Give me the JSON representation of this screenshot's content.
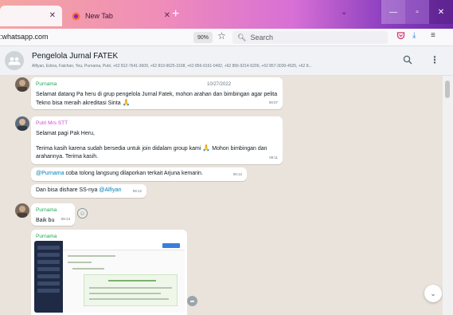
{
  "browser": {
    "active_tab_title": "",
    "inactive_tab_title": "New Tab",
    "url": ":whatsapp.com",
    "zoom": "90%",
    "search_placeholder": "Search",
    "tab_gradient": [
      "#f4a6a0",
      "#f08db9",
      "#d76fd6",
      "#8b3fbf",
      "#6a2aa8"
    ]
  },
  "chat_header": {
    "group_name": "Pengelola Jurnal FATEK",
    "members": "Alfiyan, Edora, Fatchan, You, Purnama, Putri, +62 812-7641-3609, +62 819-9625-3108, +62 856-9161-0492, +62 856-9214-5206, +62 857-3030-4025, +62 8..."
  },
  "messages": [
    {
      "sender": "Purnama",
      "sender_color": "#1fa855",
      "date": "10/27/2022",
      "text": "Selamat datang Pa heru di grup pengelola Jurnal Fatek, mohon arahan dan bimbingan agar pelita Tekno bisa meraih akreditasi Sinta",
      "emoji": "🙏",
      "time": "09:07"
    },
    {
      "sender": "Putri Mrs STT",
      "sender_color": "#c94bd0",
      "text1": "Selamat pagi Pak Heru,",
      "text2": "Terima kasih karena sudah bersedia untuk join didalam group kami",
      "text2b": "Mohon bimbingan dan arahannya. Terima kasih.",
      "emoji": "🙏",
      "time": "09:11"
    },
    {
      "mention": "@Purnama",
      "text": "coba tolong langsung dilaporkan terkait Arjuna kemarin.",
      "time": "09:12"
    },
    {
      "text": "Dan bisa dishare SS-nya",
      "mention": "@Alfiyan",
      "time": "09:12"
    },
    {
      "sender": "Purnama",
      "sender_color": "#1fa855",
      "text": "Baik bu",
      "time": "09:13"
    },
    {
      "sender": "Purnama",
      "sender_color": "#1fa855",
      "type": "image"
    }
  ],
  "icons": {
    "whatsapp_favicon": "whatsapp-icon",
    "newtab_favicon": "firefox-icon",
    "group_avatar": "group-icon",
    "react": "smiley-icon",
    "forward": "forward-icon",
    "scroll_down": "chevron-down-icon"
  }
}
